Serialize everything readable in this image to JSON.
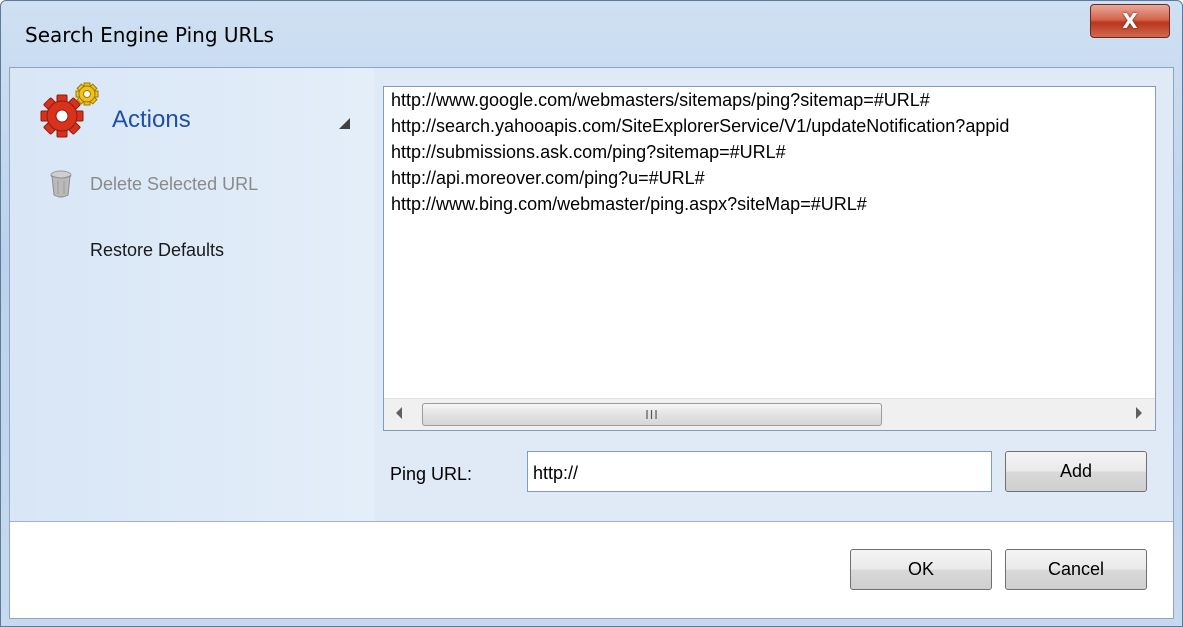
{
  "window": {
    "title": "Search Engine Ping URLs",
    "close_glyph": "X"
  },
  "sidebar": {
    "heading": "Actions",
    "heading_icon": "gears-icon",
    "items": [
      {
        "label": "Delete Selected URL",
        "icon": "trash-can-icon",
        "enabled": false
      },
      {
        "label": "Restore Defaults",
        "icon": "",
        "enabled": true
      }
    ]
  },
  "url_list": {
    "items": [
      "http://www.google.com/webmasters/sitemaps/ping?sitemap=#URL#",
      "http://search.yahooapis.com/SiteExplorerService/V1/updateNotification?appid",
      "http://submissions.ask.com/ping?sitemap=#URL#",
      "http://api.moreover.com/ping?u=#URL#",
      "http://www.bing.com/webmaster/ping.aspx?siteMap=#URL#"
    ],
    "scroll_grip": "III"
  },
  "ping_form": {
    "label": "Ping URL:",
    "value": "http://",
    "add_label": "Add"
  },
  "footer": {
    "ok_label": "OK",
    "cancel_label": "Cancel"
  },
  "colors": {
    "accent_text": "#1f4fa8",
    "close_button": "#c4432a",
    "panel_background": "#dfeaf6"
  }
}
